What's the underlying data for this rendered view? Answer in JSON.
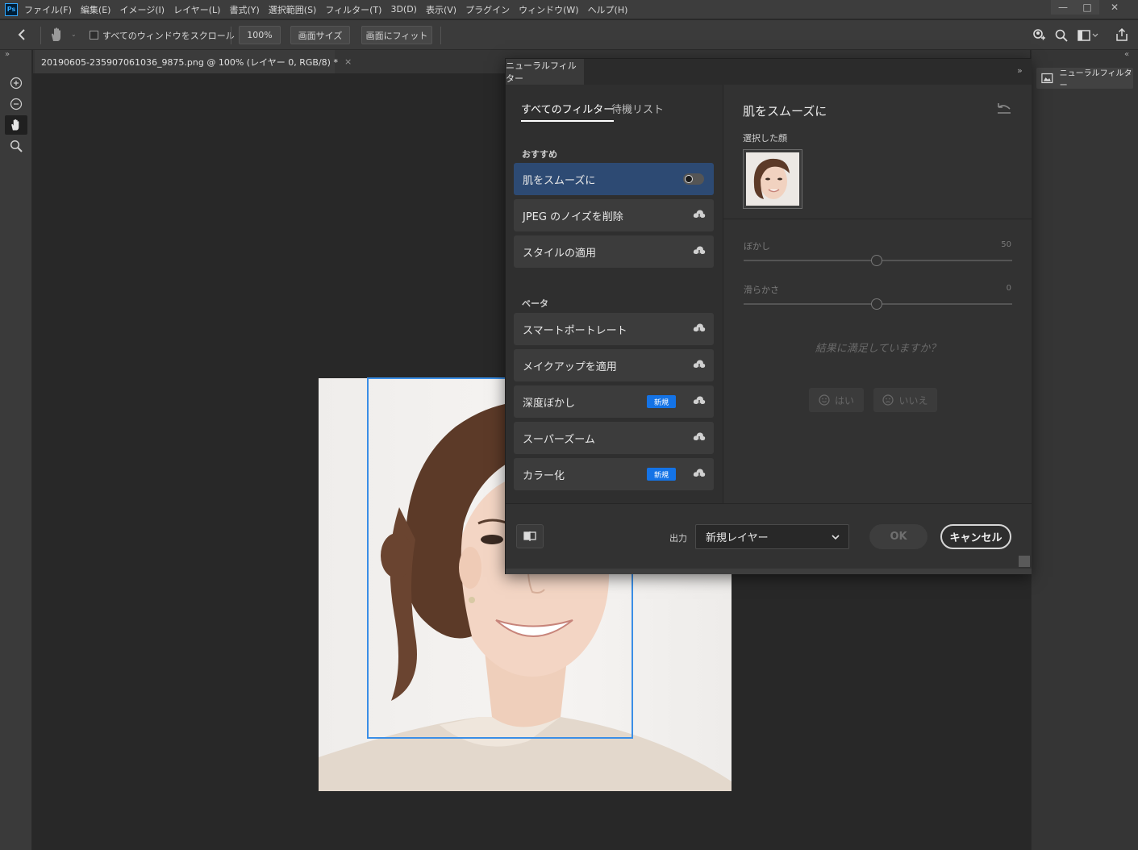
{
  "app": {
    "logo": "Ps"
  },
  "menu": [
    "ファイル(F)",
    "編集(E)",
    "イメージ(I)",
    "レイヤー(L)",
    "書式(Y)",
    "選択範囲(S)",
    "フィルター(T)",
    "3D(D)",
    "表示(V)",
    "プラグイン",
    "ウィンドウ(W)",
    "ヘルプ(H)"
  ],
  "window_controls": {
    "minimize": "—",
    "maximize": "□",
    "close": "✕"
  },
  "options": {
    "scroll_all_label": "すべてのウィンドウをスクロール",
    "zoom_value": "100%",
    "screen_size_label": "画面サイズ",
    "fit_screen_label": "画面にフィット"
  },
  "document": {
    "tab_title": "20190605-235907061036_9875.png @ 100% (レイヤー 0, RGB/8) *",
    "close": "×"
  },
  "right_panel": {
    "expand": "«",
    "item_label": "ニューラルフィルター"
  },
  "toolbar": {
    "expand": "»"
  },
  "dialog": {
    "tab_label": "ニューラルフィルター",
    "collapse": "»",
    "tabs": {
      "all": "すべてのフィルター",
      "waitlist": "待機リスト"
    },
    "recommended_label": "おすすめ",
    "beta_label": "ベータ",
    "recommended": [
      {
        "label": "肌をスムーズに",
        "state": "toggle"
      },
      {
        "label": "JPEG のノイズを削除",
        "state": "cloud"
      },
      {
        "label": "スタイルの適用",
        "state": "cloud"
      }
    ],
    "beta": [
      {
        "label": "スマートポートレート",
        "badge": ""
      },
      {
        "label": "メイクアップを適用",
        "badge": ""
      },
      {
        "label": "深度ぼかし",
        "badge": "新規"
      },
      {
        "label": "スーパーズーム",
        "badge": ""
      },
      {
        "label": "カラー化",
        "badge": "新規"
      }
    ],
    "detail": {
      "title": "肌をスムーズに",
      "selected_face_label": "選択した顔",
      "blur_label": "ぼかし",
      "blur_value": "50",
      "smooth_label": "滑らかさ",
      "smooth_value": "0",
      "feedback_question": "結果に満足していますか？",
      "yes_label": "はい",
      "no_label": "いいえ"
    },
    "footer": {
      "output_label": "出力",
      "output_value": "新規レイヤー",
      "ok_label": "OK",
      "cancel_label": "キャンセル"
    }
  },
  "colors": {
    "accent": "#1473e6",
    "active_item": "#2d4a73",
    "face_box": "#3a8ee6"
  }
}
